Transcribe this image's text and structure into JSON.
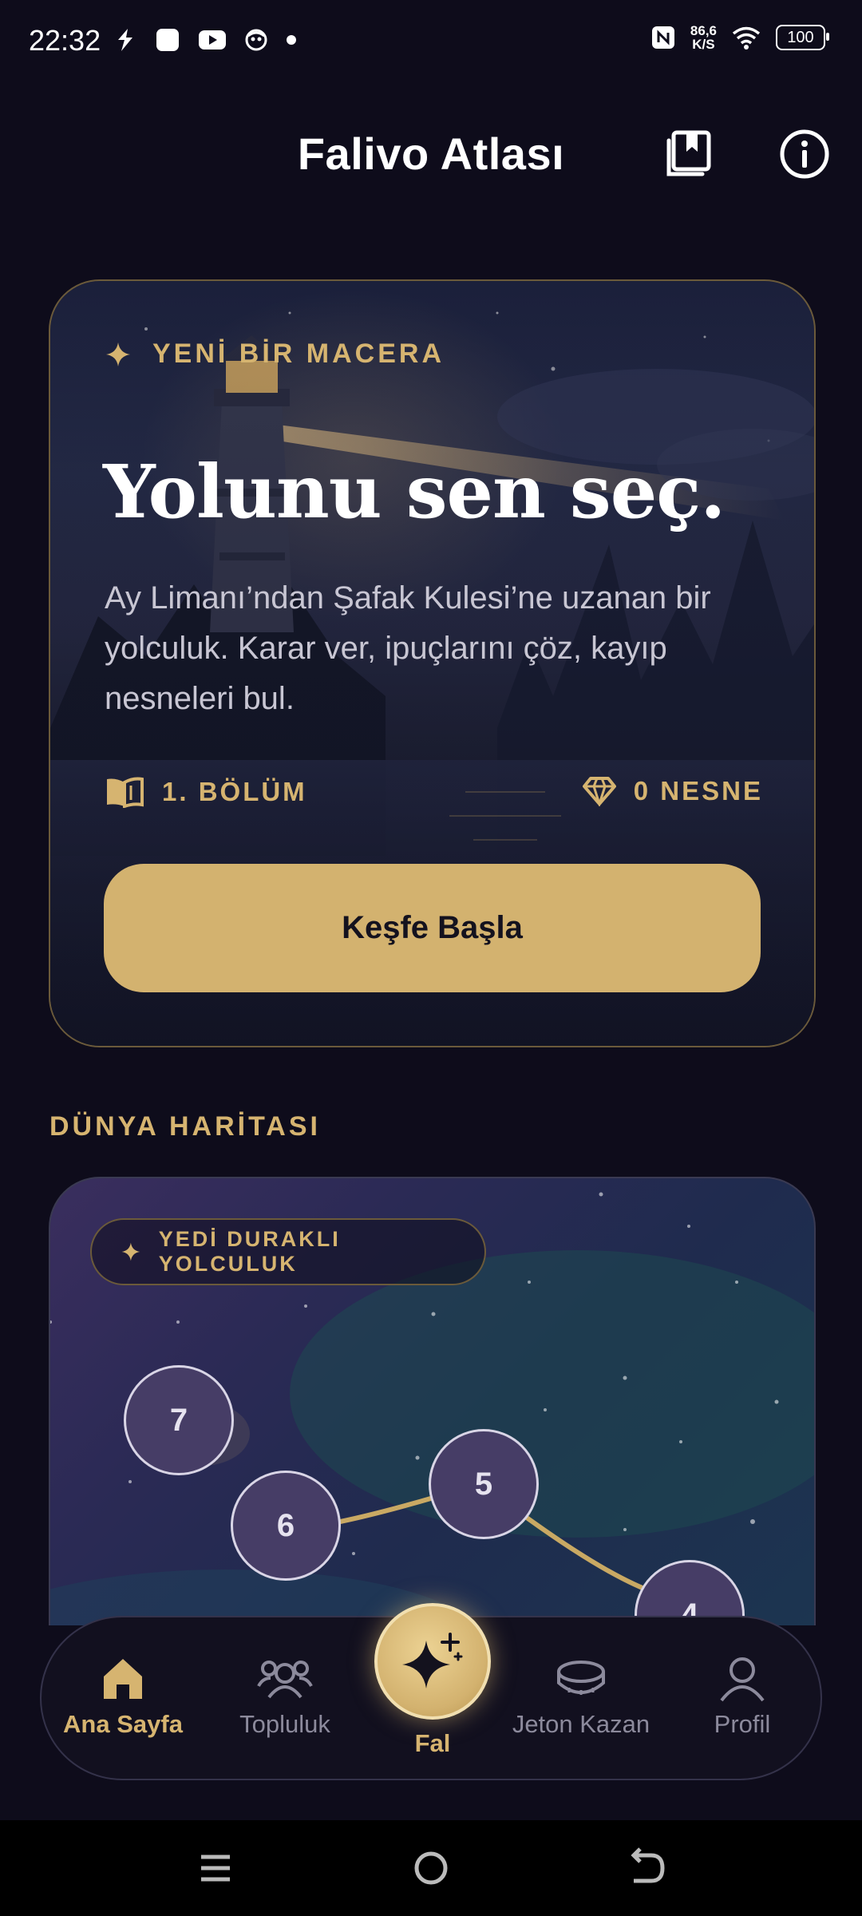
{
  "status_bar": {
    "time": "22:32",
    "speed_value": "86,6",
    "speed_unit": "K/S",
    "battery": "100",
    "icons": [
      "bolt-icon",
      "app-square-icon",
      "youtube-icon",
      "smiley-icon",
      "dot-icon",
      "nfc-icon",
      "wifi-icon",
      "battery-icon"
    ]
  },
  "header": {
    "title": "Falivo Atlası",
    "icons": [
      "bookmark-book-icon",
      "info-icon"
    ]
  },
  "hero": {
    "tag": "YENİ BİR MACERA",
    "title": "Yolunu sen seç.",
    "description": "Ay Limanı’ndan Şafak Kulesi’ne uzanan bir yolculuk. Karar ver, ipuçlarını çöz, kayıp nesneleri bul.",
    "chapter": "1. BÖLÜM",
    "items": "0 NESNE",
    "cta": "Keşfe Başla"
  },
  "map_section": {
    "title": "DÜNYA HARİTASI",
    "chip": "YEDİ DURAKLI YOLCULUK",
    "nodes": [
      "7",
      "6",
      "5",
      "4"
    ]
  },
  "bottom_nav": {
    "items": [
      {
        "label": "Ana Sayfa",
        "icon": "home-icon",
        "active": true
      },
      {
        "label": "Topluluk",
        "icon": "community-icon",
        "active": false
      },
      {
        "label": "Fal",
        "icon": "sparkle-icon",
        "active": false
      },
      {
        "label": "Jeton Kazan",
        "icon": "coin-icon",
        "active": false
      },
      {
        "label": "Profil",
        "icon": "profile-icon",
        "active": false
      }
    ]
  },
  "colors": {
    "background": "#0e0c1b",
    "accent_gold": "#d3b26f",
    "text_gold": "#d6b470",
    "node_fill": "#463d66"
  }
}
